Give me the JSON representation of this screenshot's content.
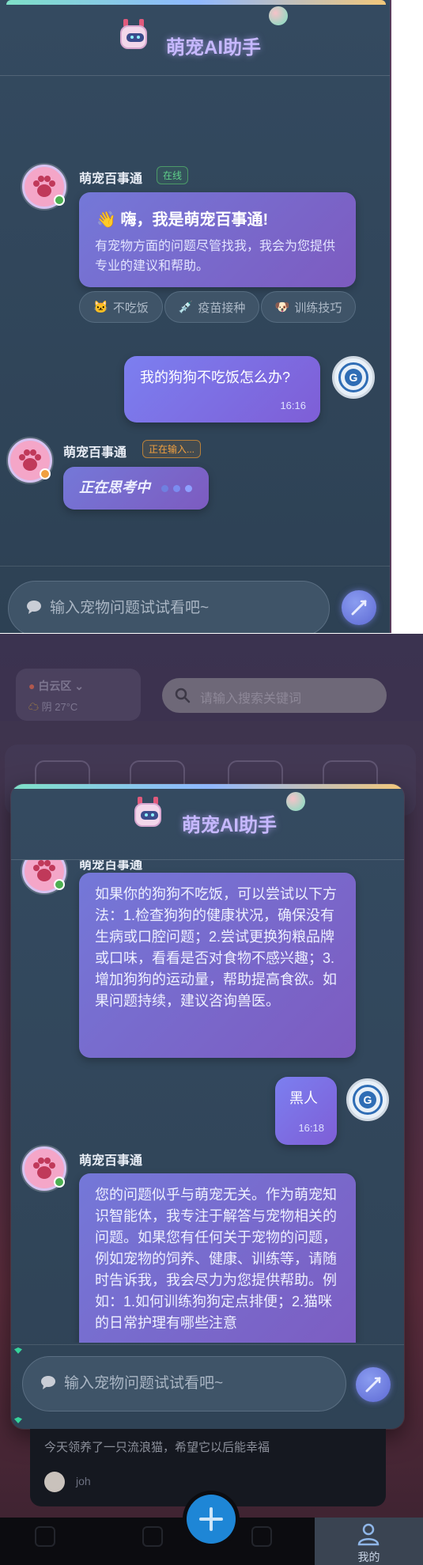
{
  "panel1": {
    "header": {
      "title": "萌宠AI助手"
    },
    "bot_msg": {
      "name": "萌宠百事通",
      "status": "在线",
      "greeting": "嗨，我是萌宠百事通!",
      "wave": "👋",
      "body": "有宠物方面的问题尽管找我，我会为您提供专业的建议和帮助。"
    },
    "chips": [
      {
        "icon": "cat-icon",
        "label": "不吃饭"
      },
      {
        "icon": "syringe-icon",
        "label": "疫苗接种"
      },
      {
        "icon": "dog-icon",
        "label": "训练技巧"
      }
    ],
    "user_msg": {
      "text": "我的狗狗不吃饭怎么办?",
      "time": "16:16"
    },
    "typing_msg": {
      "name": "萌宠百事通",
      "status": "正在输入...",
      "text": "正在思考中"
    },
    "input": {
      "placeholder": "输入宠物问题试试看吧~"
    }
  },
  "panel2": {
    "background": {
      "location": "白云区",
      "weather": "阴 27°C",
      "search_placeholder": "请输入搜索关键词",
      "post_text": "今天领养了一只流浪猫，希望它以后能幸福",
      "post_user": "joh",
      "tab_mine": "我的"
    },
    "modal": {
      "title": "萌宠AI助手",
      "bot_name_cut": "萌宠百事通",
      "answer1": "如果你的狗狗不吃饭，可以尝试以下方法：1.检查狗狗的健康状况，确保没有生病或口腔问题；2.尝试更换狗粮品牌或口味，看看是否对食物不感兴趣；3.增加狗狗的运动量，帮助提高食欲。如果问题持续，建议咨询兽医。",
      "user_msg": {
        "text": "黑人",
        "time": "16:18"
      },
      "bot_name": "萌宠百事通",
      "answer2": "您的问题似乎与萌宠无关。作为萌宠知识智能体，我专注于解答与宠物相关的问题。如果您有任何关于宠物的问题，例如宠物的饲养、健康、训练等，请随时告诉我，我会尽力为您提供帮助。例如：1.如何训练狗狗定点排便；2.猫咪的日常护理有哪些注意",
      "input_placeholder": "输入宠物问题试试看吧~"
    }
  },
  "colors": {
    "accent_purple": "#7478d8",
    "online_green": "#4caf50",
    "typing_orange": "#f0a040",
    "fab_blue": "#1e86d6"
  }
}
